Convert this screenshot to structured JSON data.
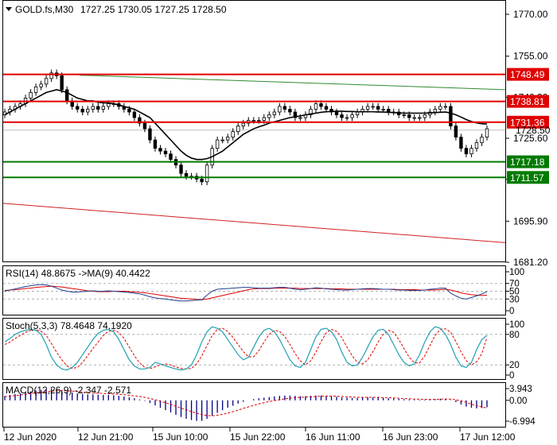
{
  "main": {
    "symbol": "GOLD.fs,M30",
    "ohlc": "1727.25 1730.05 1727.25 1728.50",
    "current_price": "1728.50",
    "price_ticks": [
      "1770.00",
      "1755.00",
      "1740.30",
      "1725.60",
      "1710.90",
      "1695.90",
      "1681.20"
    ]
  },
  "levels": [
    {
      "label": "1748.49",
      "type": "resistance",
      "color": "#e00000"
    },
    {
      "label": "1738.81",
      "type": "resistance",
      "color": "#e00000"
    },
    {
      "label": "1731.36",
      "type": "resistance",
      "color": "#e00000"
    },
    {
      "label": "1717.18",
      "type": "support",
      "color": "#007a00"
    },
    {
      "label": "1711.57",
      "type": "support",
      "color": "#007a00"
    }
  ],
  "rsi": {
    "label": "RSI(14) 48.8675 ->MA(9) 40.4422",
    "ticks": [
      "100",
      "70",
      "50",
      "30",
      "0"
    ]
  },
  "stoch": {
    "label": "Stoch(5,3,3) 78.4648 74.1920",
    "ticks": [
      "100",
      "80",
      "20",
      "0"
    ]
  },
  "macd": {
    "label": "MACD(12,26,9) -2.347 -2.571",
    "ticks": [
      "3.943",
      "0.00",
      "-6.994"
    ]
  },
  "time_axis": [
    "12 Jun 2020",
    "12 Jun 21:00",
    "15 Jun 10:00",
    "15 Jun 22:00",
    "16 Jun 11:00",
    "16 Jun 23:00",
    "17 Jun 12:00"
  ],
  "colors": {
    "candle": "#000000",
    "ma": "#000000",
    "resistance": "#e00000",
    "support": "#007a00",
    "rsi_line": "#1f3f8f",
    "rsi_signal": "#e00000",
    "stoch_main": "#20a0b0",
    "stoch_signal": "#e00000",
    "macd_hist": "#000080",
    "macd_signal": "#e00000"
  },
  "chart_data": [
    {
      "type": "candlestick",
      "title": "GOLD.fs,M30",
      "y_axis": {
        "min": 1681.2,
        "max": 1770.0,
        "ticks": [
          1770.0,
          1755.0,
          1740.3,
          1725.6,
          1710.9,
          1695.9,
          1681.2
        ]
      },
      "close": [
        1735,
        1736,
        1737,
        1738,
        1740,
        1742,
        1744,
        1745,
        1747,
        1749,
        1748,
        1743,
        1739,
        1737,
        1736,
        1735,
        1736,
        1737,
        1736,
        1737,
        1738,
        1738,
        1737,
        1736,
        1735,
        1733,
        1731,
        1729,
        1725,
        1722,
        1721,
        1720,
        1718,
        1716,
        1713,
        1712,
        1712,
        1711,
        1710,
        1716,
        1722,
        1725,
        1725,
        1726,
        1728,
        1730,
        1731,
        1732,
        1732,
        1732,
        1733,
        1734,
        1735,
        1737,
        1736,
        1735,
        1733,
        1733,
        1734,
        1736,
        1738,
        1737,
        1736,
        1735,
        1734,
        1733,
        1733,
        1734,
        1735,
        1736,
        1737,
        1737,
        1736,
        1736,
        1735,
        1735,
        1734,
        1734,
        1733,
        1733,
        1733,
        1734,
        1735,
        1736,
        1737,
        1737,
        1730,
        1726,
        1722,
        1720,
        1722,
        1724,
        1726,
        1729
      ],
      "ma": [
        1734,
        1735,
        1736,
        1737,
        1738,
        1739,
        1740,
        1741,
        1742,
        1742.5,
        1743,
        1742.5,
        1742,
        1741,
        1740,
        1739.5,
        1739,
        1739,
        1738.5,
        1738.3,
        1738.2,
        1738,
        1737.5,
        1737,
        1736.5,
        1736,
        1735,
        1734,
        1733,
        1731,
        1729,
        1727,
        1725,
        1723,
        1721,
        1719.5,
        1718.5,
        1718,
        1718,
        1718.3,
        1719,
        1720,
        1721,
        1722.5,
        1724,
        1725.5,
        1727,
        1728,
        1729,
        1729.7,
        1730.3,
        1731,
        1731.5,
        1732,
        1732.5,
        1733,
        1733.3,
        1733.6,
        1734,
        1734.3,
        1734.6,
        1734.9,
        1735.1,
        1735.2,
        1735.3,
        1735.3,
        1735.2,
        1735.2,
        1735.1,
        1735.1,
        1735.1,
        1735.1,
        1735,
        1735,
        1734.9,
        1734.8,
        1734.7,
        1734.6,
        1734.6,
        1734.6,
        1734.6,
        1734.6,
        1734.7,
        1734.8,
        1734.9,
        1735,
        1734.6,
        1734,
        1733.2,
        1732.3,
        1731.6,
        1731.1,
        1730.8,
        1730.7
      ]
    },
    {
      "type": "line",
      "title": "RSI(14)",
      "y_axis": {
        "min": 0,
        "max": 100,
        "ticks": [
          100,
          70,
          50,
          30,
          0
        ]
      },
      "series": [
        {
          "name": "RSI(14)",
          "values": [
            50,
            53,
            56,
            59,
            62,
            64,
            66,
            67,
            66,
            63,
            58,
            53,
            50,
            48,
            48,
            49,
            50,
            51,
            50,
            50,
            51,
            50,
            49,
            48,
            47,
            45,
            43,
            40,
            36,
            33,
            31,
            30,
            28,
            26,
            25,
            25,
            26,
            27,
            28,
            40,
            50,
            55,
            56,
            57,
            58,
            59,
            60,
            60,
            59,
            58,
            58,
            58,
            59,
            60,
            60,
            58,
            55,
            54,
            55,
            57,
            59,
            58,
            56,
            55,
            54,
            53,
            53,
            54,
            55,
            56,
            57,
            57,
            56,
            55,
            55,
            54,
            53,
            53,
            52,
            52,
            52,
            53,
            55,
            56,
            58,
            58,
            45,
            38,
            32,
            30,
            34,
            38,
            43,
            49
          ]
        },
        {
          "name": "MA(9)",
          "values": [
            52,
            53,
            54,
            55,
            57,
            58,
            60,
            61,
            62,
            63,
            62,
            61,
            59,
            57,
            55,
            53,
            51,
            50,
            49,
            49,
            49,
            50,
            50,
            50,
            49,
            48,
            47,
            46,
            44,
            42,
            40,
            38,
            36,
            34,
            32,
            31,
            30,
            29,
            28,
            30,
            33,
            36,
            39,
            42,
            45,
            48,
            51,
            54,
            56,
            57,
            57,
            57,
            58,
            58,
            58,
            58,
            58,
            57,
            57,
            57,
            57,
            57,
            57,
            56,
            56,
            56,
            55,
            55,
            55,
            55,
            55,
            55,
            55,
            55,
            55,
            55,
            54,
            54,
            54,
            54,
            53,
            53,
            53,
            53,
            54,
            55,
            53,
            50,
            46,
            43,
            41,
            40,
            39,
            40
          ]
        }
      ]
    },
    {
      "type": "line",
      "title": "Stoch(5,3,3)",
      "y_axis": {
        "min": 0,
        "max": 100,
        "ticks": [
          100,
          80,
          20,
          0
        ]
      },
      "series": [
        {
          "name": "%K",
          "values": [
            65,
            72,
            80,
            85,
            88,
            90,
            88,
            80,
            60,
            35,
            20,
            12,
            10,
            15,
            25,
            40,
            55,
            70,
            82,
            88,
            90,
            85,
            70,
            50,
            30,
            18,
            12,
            12,
            15,
            25,
            22,
            18,
            15,
            12,
            10,
            12,
            20,
            40,
            65,
            85,
            95,
            92,
            85,
            70,
            55,
            40,
            30,
            35,
            55,
            75,
            88,
            92,
            85,
            70,
            50,
            30,
            18,
            15,
            25,
            50,
            75,
            90,
            92,
            85,
            70,
            45,
            25,
            18,
            20,
            35,
            55,
            75,
            88,
            90,
            80,
            60,
            40,
            25,
            18,
            22,
            40,
            65,
            85,
            95,
            92,
            80,
            60,
            35,
            18,
            15,
            25,
            50,
            70,
            78
          ]
        },
        {
          "name": "%D",
          "values": [
            60,
            65,
            72,
            78,
            84,
            88,
            89,
            86,
            78,
            62,
            45,
            30,
            18,
            13,
            15,
            25,
            38,
            52,
            65,
            78,
            86,
            88,
            84,
            72,
            55,
            38,
            24,
            15,
            13,
            16,
            20,
            22,
            20,
            16,
            13,
            12,
            13,
            22,
            38,
            58,
            78,
            90,
            92,
            86,
            74,
            60,
            46,
            36,
            36,
            48,
            65,
            80,
            88,
            86,
            76,
            60,
            42,
            28,
            20,
            28,
            45,
            66,
            83,
            90,
            86,
            74,
            55,
            38,
            25,
            22,
            30,
            46,
            65,
            80,
            88,
            84,
            70,
            52,
            35,
            24,
            24,
            38,
            58,
            78,
            90,
            91,
            84,
            66,
            46,
            28,
            20,
            26,
            42,
            74
          ]
        }
      ]
    },
    {
      "type": "bar",
      "title": "MACD(12,26,9)",
      "y_axis": {
        "min": -6.994,
        "max": 3.943,
        "ticks": [
          3.943,
          0.0,
          -6.994
        ]
      },
      "series": [
        {
          "name": "MACD",
          "values": [
            1.5,
            1.8,
            2.1,
            2.4,
            2.7,
            3.0,
            3.3,
            3.5,
            3.7,
            3.9,
            3.8,
            3.4,
            3.0,
            2.6,
            2.3,
            2.1,
            2.0,
            2.0,
            1.9,
            1.8,
            1.8,
            1.7,
            1.5,
            1.3,
            1.0,
            0.7,
            0.3,
            -0.2,
            -0.9,
            -1.7,
            -2.5,
            -3.3,
            -4.1,
            -4.9,
            -5.6,
            -6.2,
            -6.6,
            -6.9,
            -6.9,
            -6.2,
            -5.2,
            -4.2,
            -3.3,
            -2.5,
            -1.8,
            -1.1,
            -0.5,
            0.0,
            0.4,
            0.7,
            0.9,
            1.1,
            1.3,
            1.5,
            1.6,
            1.6,
            1.5,
            1.4,
            1.4,
            1.5,
            1.6,
            1.6,
            1.5,
            1.4,
            1.2,
            1.0,
            0.9,
            0.8,
            0.8,
            0.9,
            1.0,
            1.0,
            0.9,
            0.8,
            0.7,
            0.6,
            0.5,
            0.4,
            0.3,
            0.2,
            0.2,
            0.2,
            0.3,
            0.4,
            0.5,
            0.6,
            0.1,
            -0.6,
            -1.4,
            -2.1,
            -2.5,
            -2.7,
            -2.6,
            -2.35
          ]
        },
        {
          "name": "Signal",
          "values": [
            1.2,
            1.4,
            1.6,
            1.8,
            2.0,
            2.3,
            2.5,
            2.7,
            2.9,
            3.1,
            3.2,
            3.3,
            3.2,
            3.1,
            2.9,
            2.8,
            2.6,
            2.5,
            2.4,
            2.3,
            2.2,
            2.1,
            2.0,
            1.9,
            1.7,
            1.5,
            1.3,
            1.0,
            0.6,
            0.2,
            -0.3,
            -0.8,
            -1.4,
            -2.0,
            -2.6,
            -3.2,
            -3.8,
            -4.3,
            -4.8,
            -5.1,
            -5.2,
            -5.0,
            -4.7,
            -4.3,
            -3.8,
            -3.3,
            -2.7,
            -2.2,
            -1.7,
            -1.2,
            -0.8,
            -0.4,
            -0.1,
            0.2,
            0.5,
            0.7,
            0.9,
            1.0,
            1.1,
            1.2,
            1.3,
            1.4,
            1.4,
            1.4,
            1.4,
            1.3,
            1.2,
            1.1,
            1.0,
            1.0,
            1.0,
            1.0,
            1.0,
            0.9,
            0.9,
            0.8,
            0.7,
            0.6,
            0.5,
            0.4,
            0.4,
            0.3,
            0.3,
            0.3,
            0.4,
            0.4,
            0.4,
            0.2,
            -0.2,
            -0.7,
            -1.3,
            -1.8,
            -2.2,
            -2.57
          ]
        }
      ]
    }
  ]
}
